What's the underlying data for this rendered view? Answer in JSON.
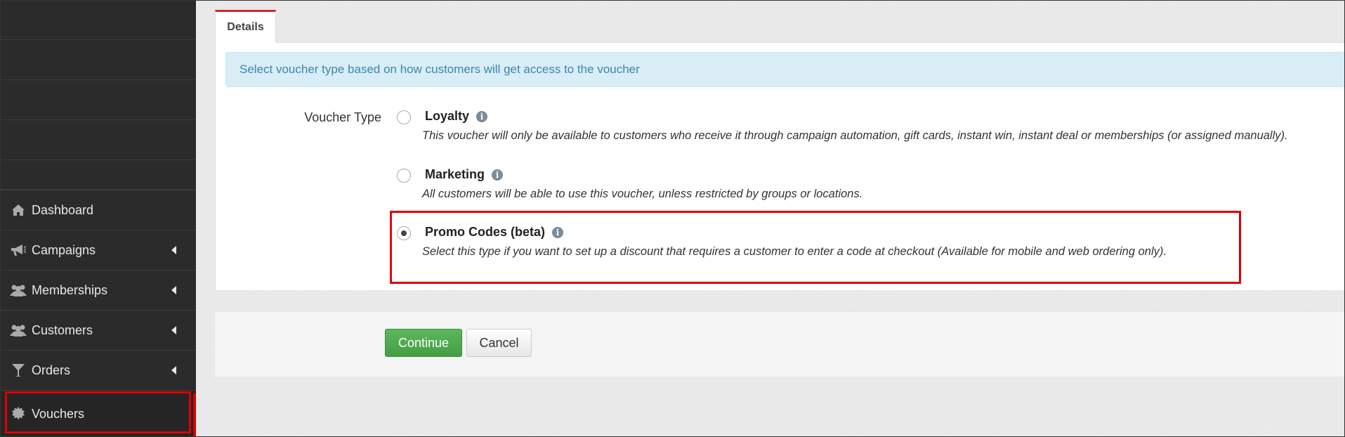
{
  "sidebar": {
    "items": [
      {
        "label": "Dashboard",
        "icon": "home-icon",
        "has_caret": false
      },
      {
        "label": "Campaigns",
        "icon": "megaphone-icon",
        "has_caret": true
      },
      {
        "label": "Memberships",
        "icon": "users-icon",
        "has_caret": true
      },
      {
        "label": "Customers",
        "icon": "users-icon",
        "has_caret": true
      },
      {
        "label": "Orders",
        "icon": "cocktail-glass-icon",
        "has_caret": true
      },
      {
        "label": "Vouchers",
        "icon": "gear-badge-icon",
        "has_caret": false,
        "active": true
      }
    ]
  },
  "tabs": {
    "details_label": "Details"
  },
  "alert": {
    "text": "Select voucher type based on how customers will get access to the voucher"
  },
  "form": {
    "voucher_type_label": "Voucher Type",
    "options": [
      {
        "title": "Loyalty",
        "description": "This voucher will only be available to customers who receive it through campaign automation, gift cards, instant win, instant deal or memberships (or assigned manually).",
        "checked": false
      },
      {
        "title": "Marketing",
        "description": "All customers will be able to use this voucher, unless restricted by groups or locations.",
        "checked": false
      },
      {
        "title": "Promo Codes (beta)",
        "description": "Select this type if you want to set up a discount that requires a customer to enter a code at checkout (Available for mobile and web ordering only).",
        "checked": true
      }
    ],
    "info_glyph": "i"
  },
  "actions": {
    "continue_label": "Continue",
    "cancel_label": "Cancel"
  },
  "colors": {
    "sidebar_bg": "#2b2b2b",
    "accent_red": "#d9252a",
    "highlight_red": "#e00000",
    "success_green": "#5cb85c",
    "info_bg": "#d9edf7",
    "info_text": "#3a87ad"
  }
}
